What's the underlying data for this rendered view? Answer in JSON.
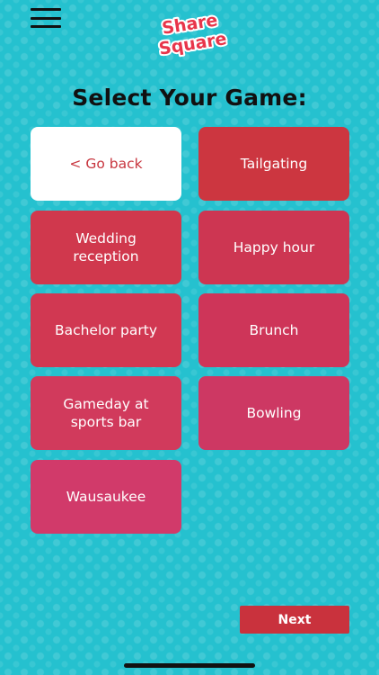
{
  "header": {
    "logo_line1": "Share",
    "logo_line2": "Square"
  },
  "title": "Select Your Game:",
  "tiles": [
    {
      "label": "< Go back",
      "color": "#ffffff"
    },
    {
      "label": "Tailgating",
      "color": "#cc3640"
    },
    {
      "label": "Wedding reception",
      "color": "#d0384d"
    },
    {
      "label": "Happy hour",
      "color": "#cd3652"
    },
    {
      "label": "Bachelor party",
      "color": "#d13852"
    },
    {
      "label": "Brunch",
      "color": "#ce3559"
    },
    {
      "label": "Gameday at sports bar",
      "color": "#d13a5c"
    },
    {
      "label": "Bowling",
      "color": "#cd3863"
    },
    {
      "label": "Wausaukee",
      "color": "#d13a6a"
    }
  ],
  "footer": {
    "next_label": "Next",
    "next_color": "#c9323d"
  },
  "colors": {
    "background": "#25c1cf",
    "logo": "#e8354a"
  }
}
